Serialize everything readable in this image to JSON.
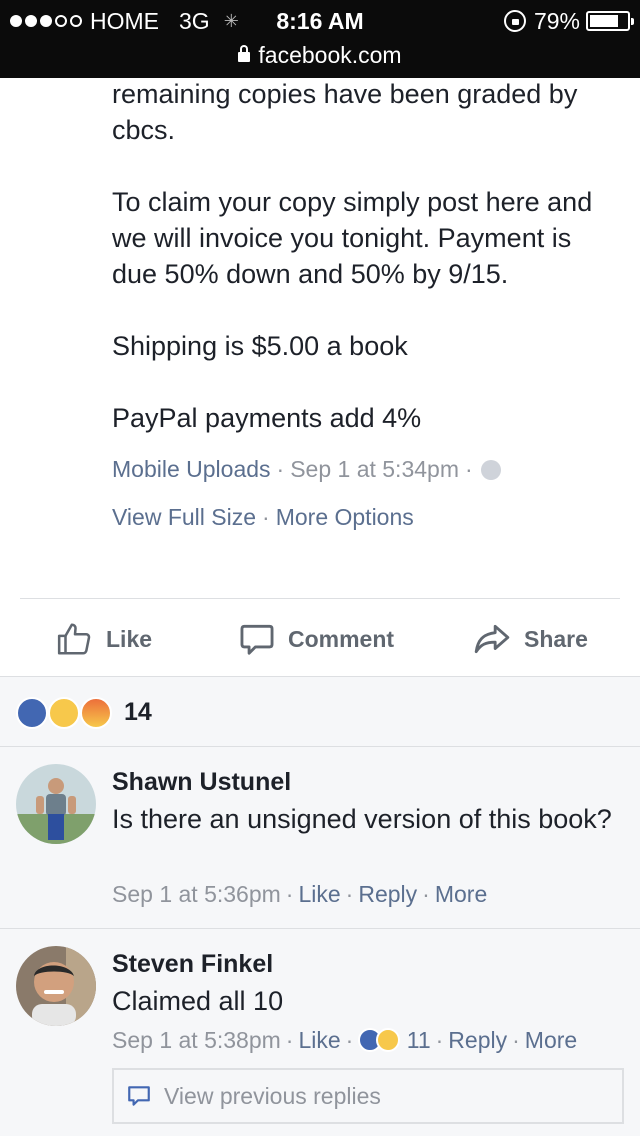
{
  "status_bar": {
    "carrier": "HOME",
    "network": "3G",
    "time": "8:16 AM",
    "battery": "79%",
    "battery_level": 0.79,
    "url": "facebook.com"
  },
  "post": {
    "paragraphs": [
      "remaining copies have been graded by cbcs.",
      "To claim your copy simply post here and we will invoice you tonight. Payment is due 50% down and 50% by 9/15.",
      "Shipping is $5.00 a book",
      "PayPal payments add 4%"
    ],
    "album": "Mobile Uploads",
    "timestamp": "Sep 1 at 5:34pm",
    "view_full_size": "View Full Size",
    "more_options": "More Options"
  },
  "actions": {
    "like": "Like",
    "comment": "Comment",
    "share": "Share"
  },
  "reactions": {
    "types": [
      "like",
      "wow",
      "angry"
    ],
    "count": "14"
  },
  "comments": [
    {
      "author": "Shawn Ustunel",
      "text": "Is there an unsigned version of this book?",
      "time": "Sep 1 at 5:36pm",
      "like": "Like",
      "reply": "Reply",
      "more": "More"
    },
    {
      "author": "Steven Finkel",
      "text": "Claimed all 10",
      "time": "Sep 1 at 5:38pm",
      "like": "Like",
      "reaction_count": "11",
      "reply": "Reply",
      "more": "More"
    }
  ],
  "view_previous_replies": "View previous replies",
  "colors": {
    "link": "#5b6f8f",
    "meta_grey": "#90949c",
    "facebook_blue": "#4267b2",
    "status_bar": "#0b0b0b"
  }
}
